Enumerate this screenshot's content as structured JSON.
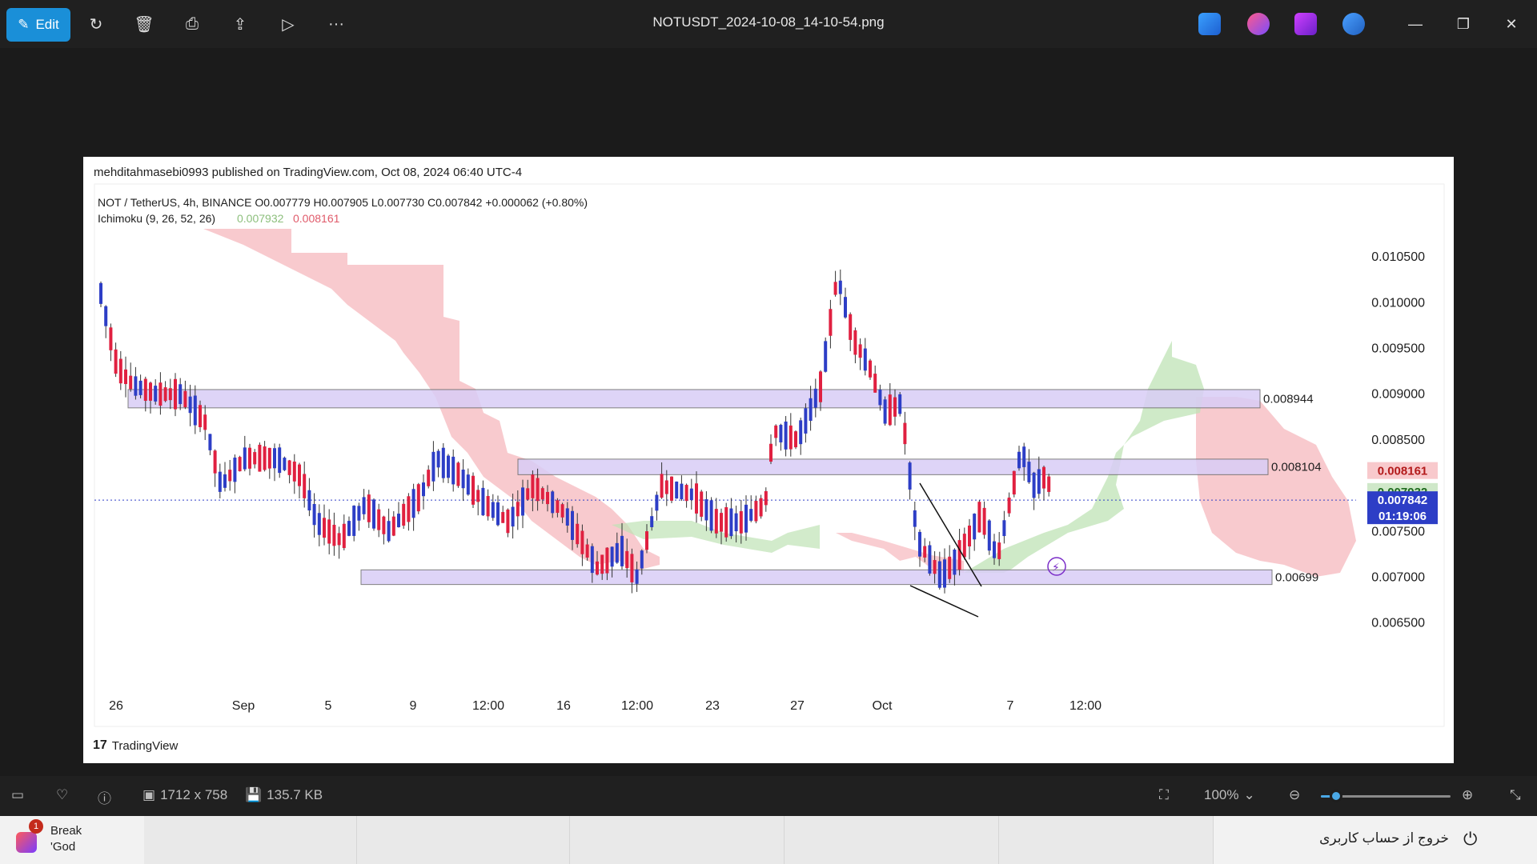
{
  "titlebar": {
    "edit_label": "Edit",
    "file_name": "NOTUSDT_2024-10-08_14-10-54.png",
    "icons": [
      "edit-icon",
      "rotate-icon",
      "delete-icon",
      "print-icon",
      "share-icon",
      "slideshow-icon",
      "more-icon"
    ],
    "window_controls": [
      "minimize",
      "restore",
      "close"
    ]
  },
  "image": {
    "published_line": "mehditahmasebi0993 published on TradingView.com, Oct 08, 2024 06:40 UTC-4",
    "legend_line1": "NOT / TetherUS, 4h, BINANCE  O0.007779  H0.007905  L0.007730  C0.007842  +0.000062 (+0.80%)",
    "legend_line2_name": "Ichimoku (9, 26, 52, 26)",
    "legend_line2_val1": "0.007932",
    "legend_line2_val2": "0.008161",
    "brand": "TradingView"
  },
  "chart_data": {
    "type": "candlestick",
    "symbol": "NOT / TetherUS",
    "interval": "4h",
    "exchange": "BINANCE",
    "ohlc_last": {
      "open": 0.007779,
      "high": 0.007905,
      "low": 0.00773,
      "close": 0.007842,
      "change": 6.2e-05,
      "change_pct": "+0.80%"
    },
    "y_ticks": [
      "0.010500",
      "0.010000",
      "0.009500",
      "0.009000",
      "0.008500",
      "0.007500",
      "0.007000",
      "0.006500"
    ],
    "ylim": [
      0.0062,
      0.0112
    ],
    "x_ticks": [
      "26",
      "Sep",
      "5",
      "9",
      "12:00",
      "16",
      "12:00",
      "23",
      "27",
      "Oct",
      "7",
      "12:00"
    ],
    "zones": [
      {
        "label": "0.008944",
        "low": 0.00885,
        "high": 0.00905
      },
      {
        "label": "0.008104",
        "low": 0.00812,
        "high": 0.00829
      },
      {
        "label": "0.00699",
        "low": 0.00692,
        "high": 0.00708
      }
    ],
    "price_labels": [
      {
        "text": "0.008161",
        "color": "#f8c9cc",
        "text_color": "#b31b1b"
      },
      {
        "text": "0.007932",
        "color": "#cfe8c9",
        "text_color": "#1f6b1f"
      },
      {
        "text": "0.007842",
        "color": "#2d3ec6",
        "text_color": "#ffffff"
      },
      {
        "text": "01:19:06",
        "color": "#2d3ec6",
        "text_color": "#ffffff"
      }
    ],
    "colors": {
      "up": "#2d3ec6",
      "down": "#e02040",
      "cloud_bear": "#f6b8bd",
      "cloud_bull": "#bfe3b5",
      "zone": "#d9cdf6"
    }
  },
  "statusbar": {
    "dimensions": "1712 x 758",
    "file_size": "135.7 KB",
    "zoom": "100%",
    "zoom_fraction": 0.12
  },
  "taskbar": {
    "news_title": "Break",
    "news_sub": "'God",
    "news_badge": "1",
    "logout": "خروج از حساب کاربری"
  }
}
